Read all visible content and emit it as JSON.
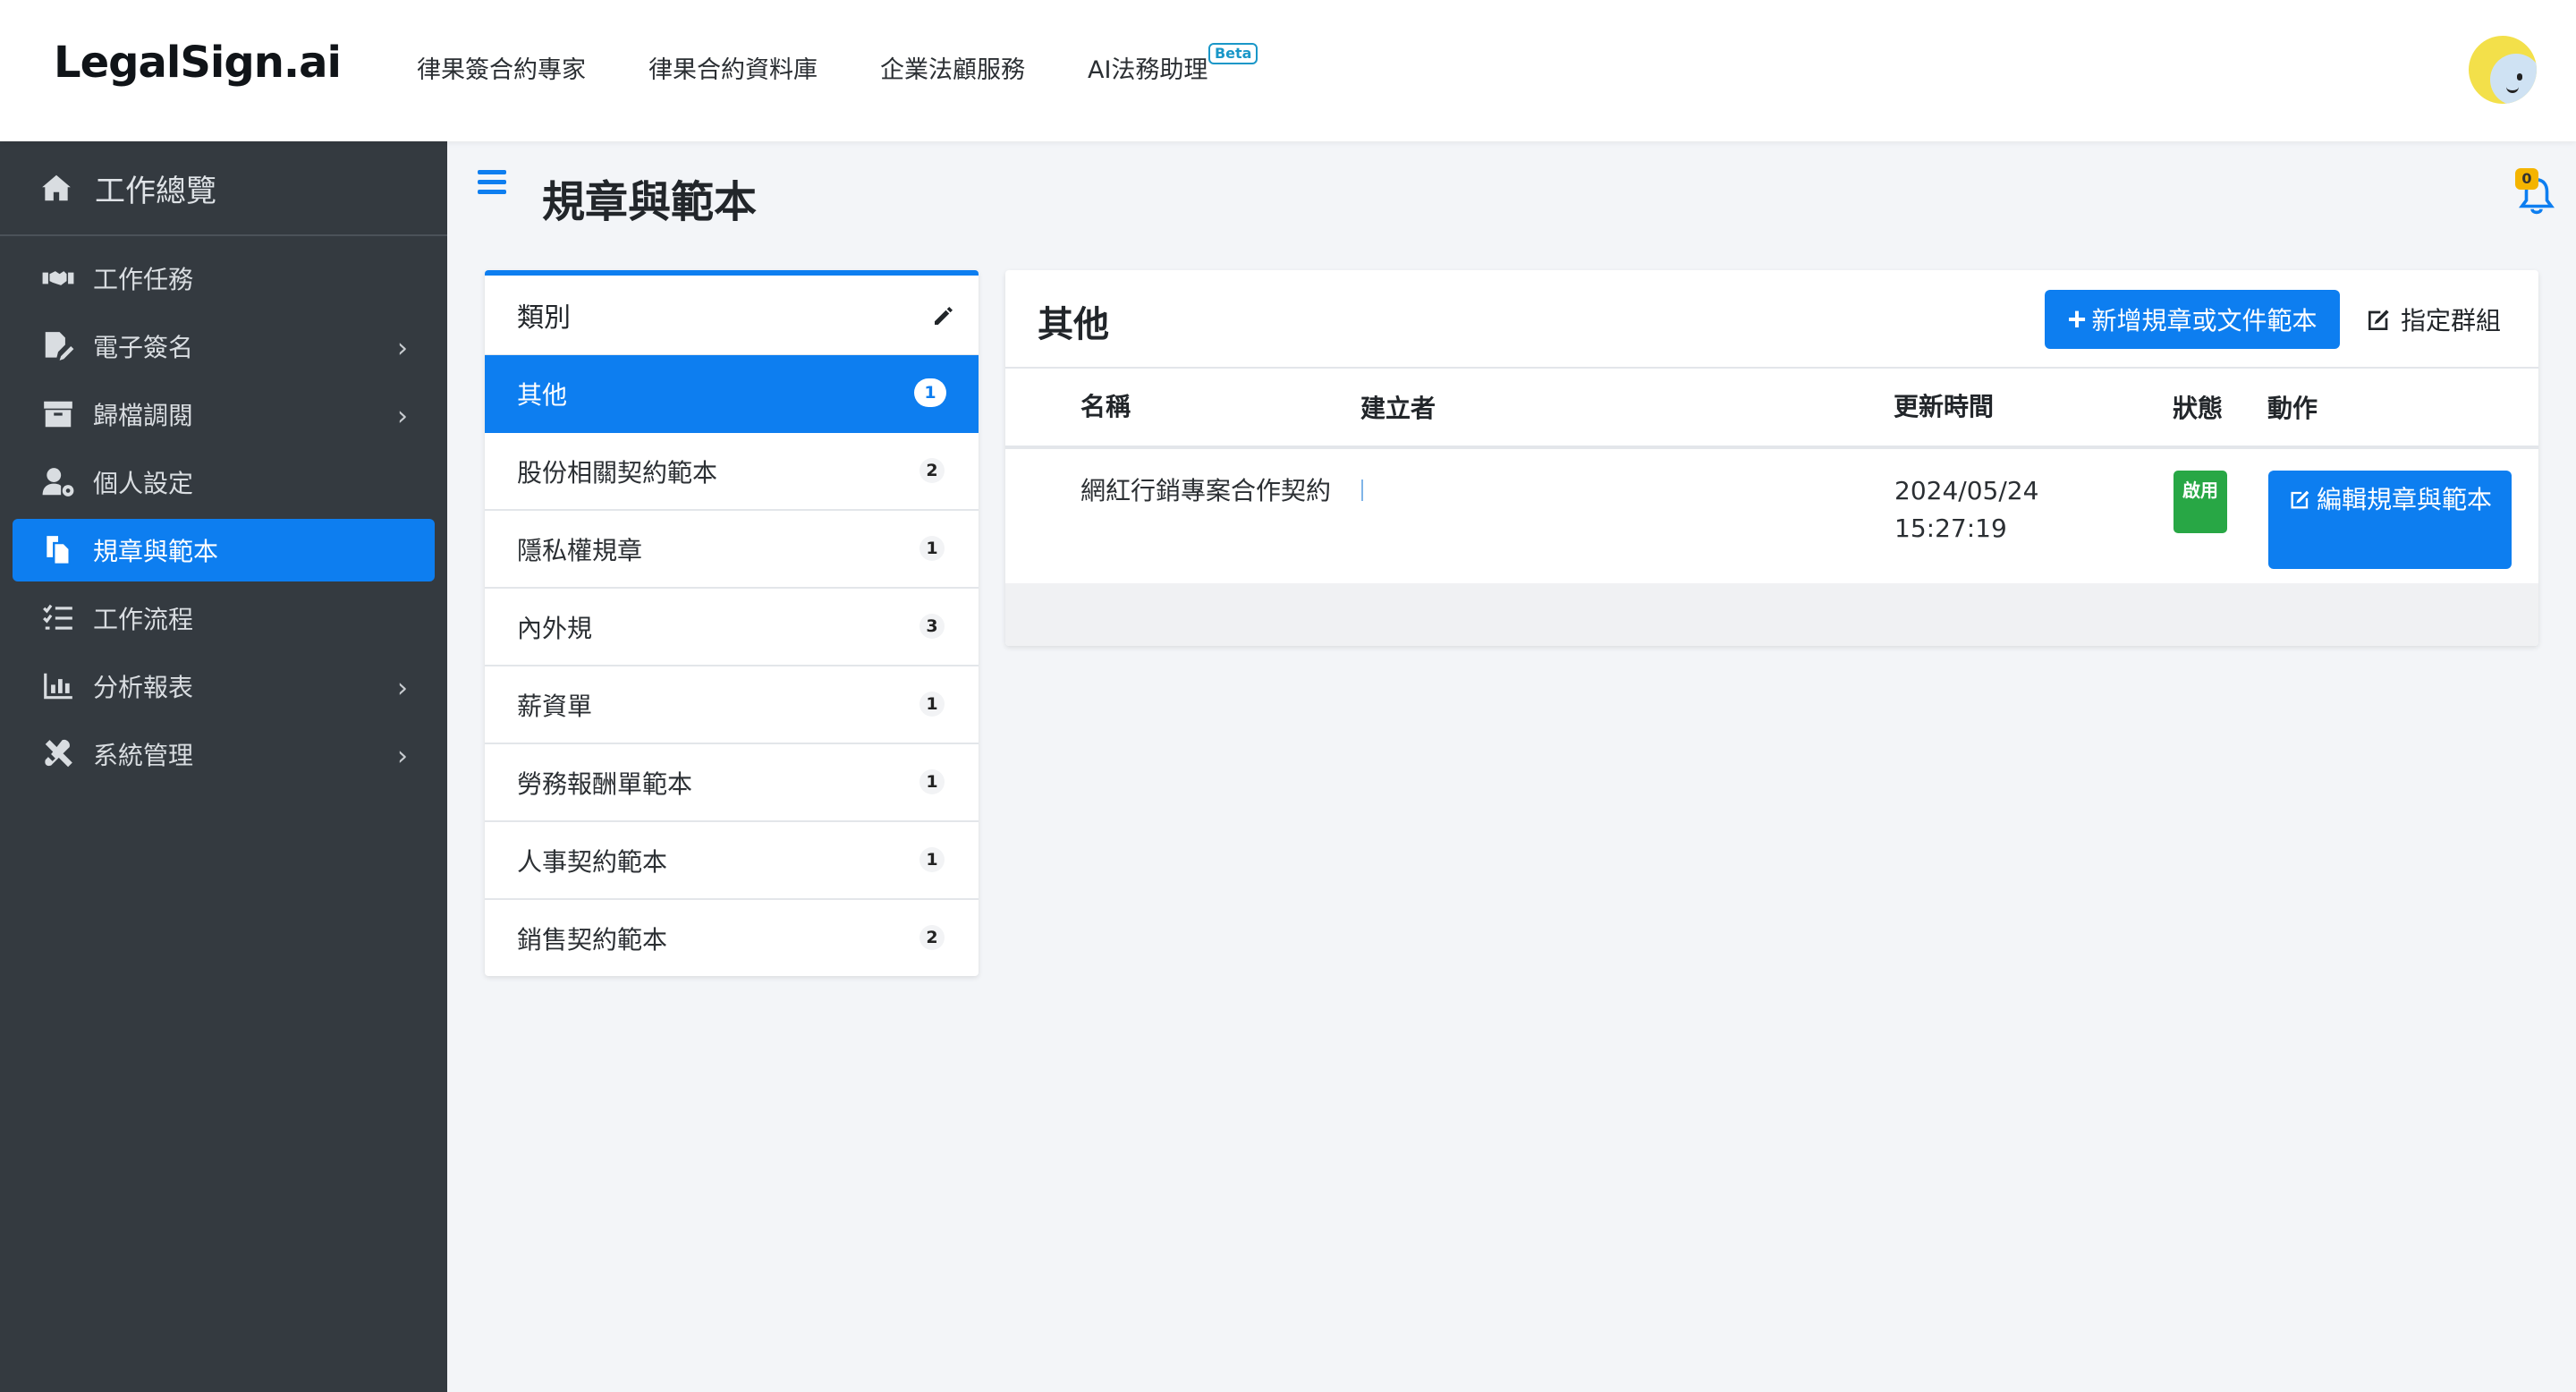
{
  "brand": {
    "logo": "LegalSign.ai"
  },
  "topnav": [
    {
      "label": "律果簽合約專家"
    },
    {
      "label": "律果合約資料庫"
    },
    {
      "label": "企業法顧服務"
    },
    {
      "label": "AI法務助理",
      "badge": "Beta"
    }
  ],
  "sidebar": {
    "header": {
      "label": "工作總覽",
      "icon": "home-icon"
    },
    "items": [
      {
        "label": "工作任務",
        "icon": "handshake-icon",
        "has_children": false
      },
      {
        "label": "電子簽名",
        "icon": "signature-icon",
        "has_children": true
      },
      {
        "label": "歸檔調閱",
        "icon": "archive-icon",
        "has_children": true
      },
      {
        "label": "個人設定",
        "icon": "user-gear-icon",
        "has_children": false
      },
      {
        "label": "規章與範本",
        "icon": "copy-icon",
        "has_children": false,
        "active": true
      },
      {
        "label": "工作流程",
        "icon": "list-check-icon",
        "has_children": false
      },
      {
        "label": "分析報表",
        "icon": "bar-chart-icon",
        "has_children": true
      },
      {
        "label": "系統管理",
        "icon": "tools-icon",
        "has_children": true
      }
    ]
  },
  "page": {
    "title": "規章與範本",
    "notification_count": "0"
  },
  "categories": {
    "header": "類別",
    "items": [
      {
        "label": "其他",
        "count": "1",
        "active": true
      },
      {
        "label": "股份相關契約範本",
        "count": "2"
      },
      {
        "label": "隱私權規章",
        "count": "1"
      },
      {
        "label": "內外規",
        "count": "3"
      },
      {
        "label": "薪資單",
        "count": "1"
      },
      {
        "label": "勞務報酬單範本",
        "count": "1"
      },
      {
        "label": "人事契約範本",
        "count": "1"
      },
      {
        "label": "銷售契約範本",
        "count": "2"
      }
    ]
  },
  "content": {
    "title": "其他",
    "add_button": "新增規章或文件範本",
    "group_button": "指定群組",
    "columns": {
      "name": "名稱",
      "creator": "建立者",
      "updated": "更新時間",
      "status": "狀態",
      "action": "動作"
    },
    "rows": [
      {
        "name": "網紅行銷專案合作契約",
        "creator": "",
        "updated_date": "2024/05/24",
        "updated_time": "15:27:19",
        "status": "啟用",
        "action": "編輯規章與範本"
      }
    ]
  },
  "colors": {
    "primary": "#0d7ef0",
    "sidebar": "#343a40",
    "success": "#28a745",
    "warning": "#f4b400"
  }
}
